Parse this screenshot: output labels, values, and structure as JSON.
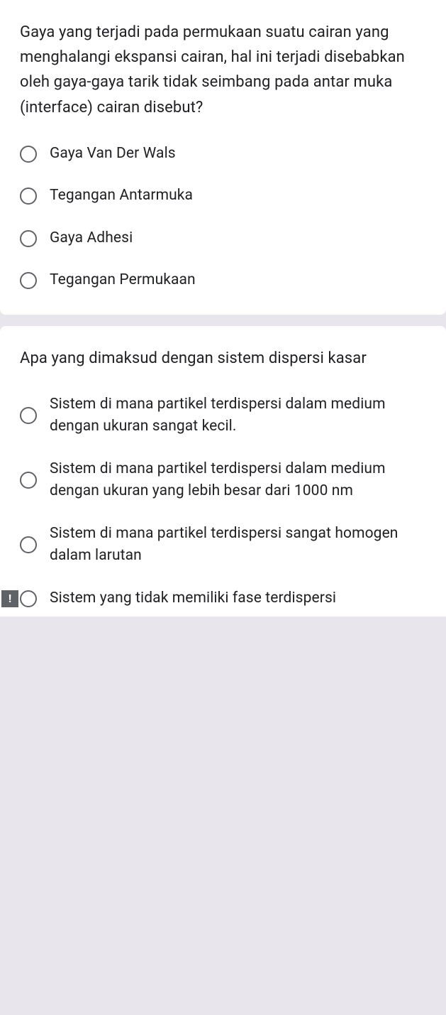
{
  "questions": [
    {
      "text": "Gaya yang terjadi pada permukaan suatu cairan yang menghalangi ekspansi cairan, hal ini terjadi disebabkan oleh gaya-gaya tarik tidak seimbang pada antar muka (interface) cairan disebut?",
      "options": [
        "Gaya Van Der Wals",
        "Tegangan Antarmuka",
        "Gaya Adhesi",
        "Tegangan Permukaan"
      ]
    },
    {
      "text": "Apa yang dimaksud dengan sistem dispersi kasar",
      "options": [
        "Sistem di mana partikel terdispersi dalam medium dengan ukuran sangat kecil.",
        "Sistem di mana partikel terdispersi dalam medium dengan ukuran yang lebih besar dari 1000 nm",
        "Sistem di mana partikel terdispersi sangat homogen dalam larutan",
        "Sistem yang tidak memiliki fase terdispersi"
      ]
    }
  ],
  "alert_symbol": "!"
}
